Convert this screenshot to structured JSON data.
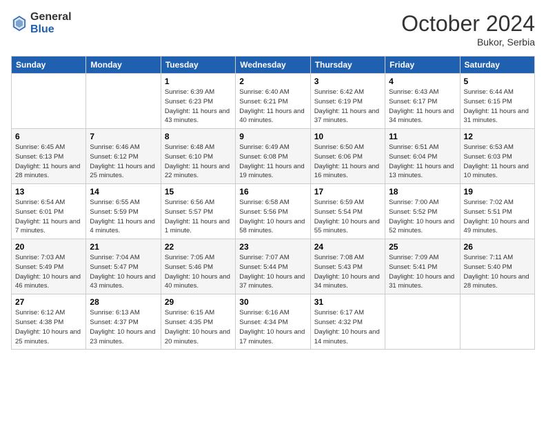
{
  "header": {
    "logo_general": "General",
    "logo_blue": "Blue",
    "month_title": "October 2024",
    "location": "Bukor, Serbia"
  },
  "weekdays": [
    "Sunday",
    "Monday",
    "Tuesday",
    "Wednesday",
    "Thursday",
    "Friday",
    "Saturday"
  ],
  "weeks": [
    [
      {
        "day": "",
        "info": ""
      },
      {
        "day": "",
        "info": ""
      },
      {
        "day": "1",
        "info": "Sunrise: 6:39 AM\nSunset: 6:23 PM\nDaylight: 11 hours and 43 minutes."
      },
      {
        "day": "2",
        "info": "Sunrise: 6:40 AM\nSunset: 6:21 PM\nDaylight: 11 hours and 40 minutes."
      },
      {
        "day": "3",
        "info": "Sunrise: 6:42 AM\nSunset: 6:19 PM\nDaylight: 11 hours and 37 minutes."
      },
      {
        "day": "4",
        "info": "Sunrise: 6:43 AM\nSunset: 6:17 PM\nDaylight: 11 hours and 34 minutes."
      },
      {
        "day": "5",
        "info": "Sunrise: 6:44 AM\nSunset: 6:15 PM\nDaylight: 11 hours and 31 minutes."
      }
    ],
    [
      {
        "day": "6",
        "info": "Sunrise: 6:45 AM\nSunset: 6:13 PM\nDaylight: 11 hours and 28 minutes."
      },
      {
        "day": "7",
        "info": "Sunrise: 6:46 AM\nSunset: 6:12 PM\nDaylight: 11 hours and 25 minutes."
      },
      {
        "day": "8",
        "info": "Sunrise: 6:48 AM\nSunset: 6:10 PM\nDaylight: 11 hours and 22 minutes."
      },
      {
        "day": "9",
        "info": "Sunrise: 6:49 AM\nSunset: 6:08 PM\nDaylight: 11 hours and 19 minutes."
      },
      {
        "day": "10",
        "info": "Sunrise: 6:50 AM\nSunset: 6:06 PM\nDaylight: 11 hours and 16 minutes."
      },
      {
        "day": "11",
        "info": "Sunrise: 6:51 AM\nSunset: 6:04 PM\nDaylight: 11 hours and 13 minutes."
      },
      {
        "day": "12",
        "info": "Sunrise: 6:53 AM\nSunset: 6:03 PM\nDaylight: 11 hours and 10 minutes."
      }
    ],
    [
      {
        "day": "13",
        "info": "Sunrise: 6:54 AM\nSunset: 6:01 PM\nDaylight: 11 hours and 7 minutes."
      },
      {
        "day": "14",
        "info": "Sunrise: 6:55 AM\nSunset: 5:59 PM\nDaylight: 11 hours and 4 minutes."
      },
      {
        "day": "15",
        "info": "Sunrise: 6:56 AM\nSunset: 5:57 PM\nDaylight: 11 hours and 1 minute."
      },
      {
        "day": "16",
        "info": "Sunrise: 6:58 AM\nSunset: 5:56 PM\nDaylight: 10 hours and 58 minutes."
      },
      {
        "day": "17",
        "info": "Sunrise: 6:59 AM\nSunset: 5:54 PM\nDaylight: 10 hours and 55 minutes."
      },
      {
        "day": "18",
        "info": "Sunrise: 7:00 AM\nSunset: 5:52 PM\nDaylight: 10 hours and 52 minutes."
      },
      {
        "day": "19",
        "info": "Sunrise: 7:02 AM\nSunset: 5:51 PM\nDaylight: 10 hours and 49 minutes."
      }
    ],
    [
      {
        "day": "20",
        "info": "Sunrise: 7:03 AM\nSunset: 5:49 PM\nDaylight: 10 hours and 46 minutes."
      },
      {
        "day": "21",
        "info": "Sunrise: 7:04 AM\nSunset: 5:47 PM\nDaylight: 10 hours and 43 minutes."
      },
      {
        "day": "22",
        "info": "Sunrise: 7:05 AM\nSunset: 5:46 PM\nDaylight: 10 hours and 40 minutes."
      },
      {
        "day": "23",
        "info": "Sunrise: 7:07 AM\nSunset: 5:44 PM\nDaylight: 10 hours and 37 minutes."
      },
      {
        "day": "24",
        "info": "Sunrise: 7:08 AM\nSunset: 5:43 PM\nDaylight: 10 hours and 34 minutes."
      },
      {
        "day": "25",
        "info": "Sunrise: 7:09 AM\nSunset: 5:41 PM\nDaylight: 10 hours and 31 minutes."
      },
      {
        "day": "26",
        "info": "Sunrise: 7:11 AM\nSunset: 5:40 PM\nDaylight: 10 hours and 28 minutes."
      }
    ],
    [
      {
        "day": "27",
        "info": "Sunrise: 6:12 AM\nSunset: 4:38 PM\nDaylight: 10 hours and 25 minutes."
      },
      {
        "day": "28",
        "info": "Sunrise: 6:13 AM\nSunset: 4:37 PM\nDaylight: 10 hours and 23 minutes."
      },
      {
        "day": "29",
        "info": "Sunrise: 6:15 AM\nSunset: 4:35 PM\nDaylight: 10 hours and 20 minutes."
      },
      {
        "day": "30",
        "info": "Sunrise: 6:16 AM\nSunset: 4:34 PM\nDaylight: 10 hours and 17 minutes."
      },
      {
        "day": "31",
        "info": "Sunrise: 6:17 AM\nSunset: 4:32 PM\nDaylight: 10 hours and 14 minutes."
      },
      {
        "day": "",
        "info": ""
      },
      {
        "day": "",
        "info": ""
      }
    ]
  ]
}
